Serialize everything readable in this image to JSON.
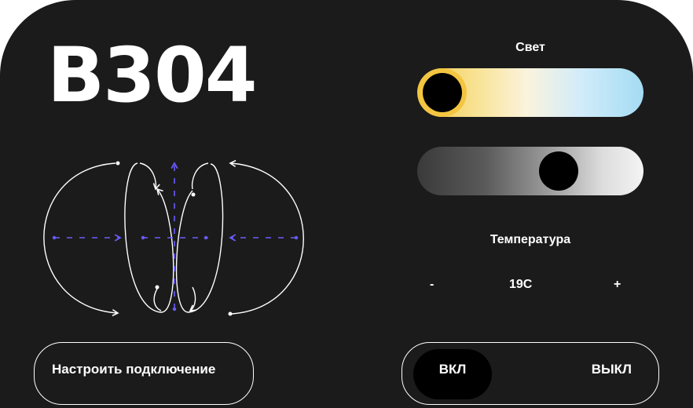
{
  "room": {
    "title": "В304"
  },
  "light": {
    "label": "Свет",
    "warmth_level": 0,
    "brightness_level": 0.66
  },
  "temperature": {
    "label": "Температура",
    "decrease_label": "-",
    "value": "19C",
    "increase_label": "+"
  },
  "actions": {
    "connect_label": "Настроить подключение"
  },
  "power": {
    "on_label": "ВКЛ",
    "off_label": "ВЫКЛ",
    "state": "on"
  },
  "colors": {
    "panel": "#1b1b1b",
    "accent_arrows": "#6a5cff",
    "warm": "#f3c845",
    "cool": "#a4dcf3"
  },
  "icons": {
    "diagram": "magnetic-field-diagram"
  }
}
